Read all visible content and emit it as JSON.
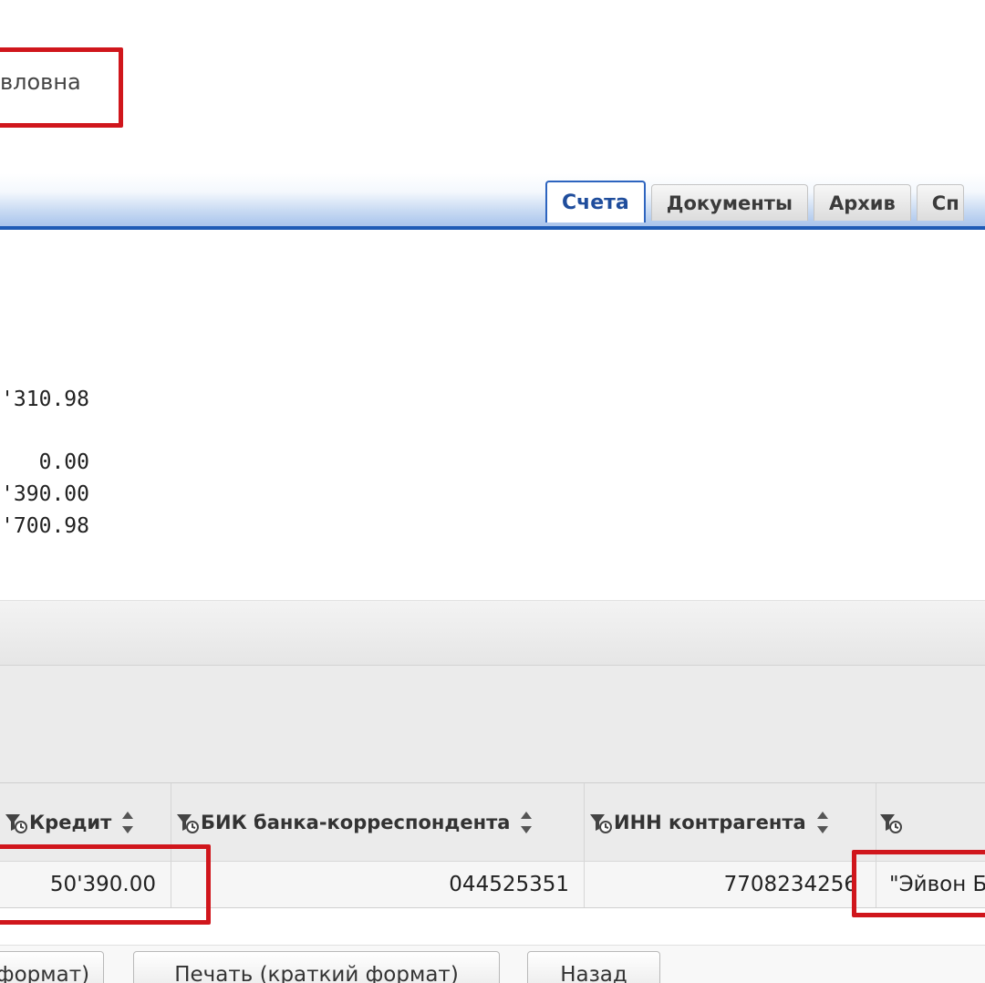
{
  "header": {
    "owner_name": "вловна"
  },
  "tabs": [
    {
      "label": "Счета",
      "active": true
    },
    {
      "label": "Документы",
      "active": false
    },
    {
      "label": "Архив",
      "active": false
    },
    {
      "label": "Сп",
      "active": false
    }
  ],
  "balances": {
    "opening": "'310.98",
    "debit": "0.00",
    "credit": "'390.00",
    "closing": "'700.98"
  },
  "grid": {
    "columns": [
      {
        "label": "Кредит"
      },
      {
        "label": "БИК банка-корреспондента"
      },
      {
        "label": "ИНН контрагента"
      },
      {
        "label": ""
      }
    ],
    "rows": [
      {
        "credit": "50'390.00",
        "bic": "044525351",
        "inn": "7708234256",
        "counterparty": "\"Эйвон Б"
      }
    ]
  },
  "buttons": {
    "print_full": "формат)",
    "print_short": "Печать (краткий формат)",
    "back": "Назад"
  },
  "colors": {
    "highlight": "#d0161c",
    "accent": "#1f5bb5"
  }
}
